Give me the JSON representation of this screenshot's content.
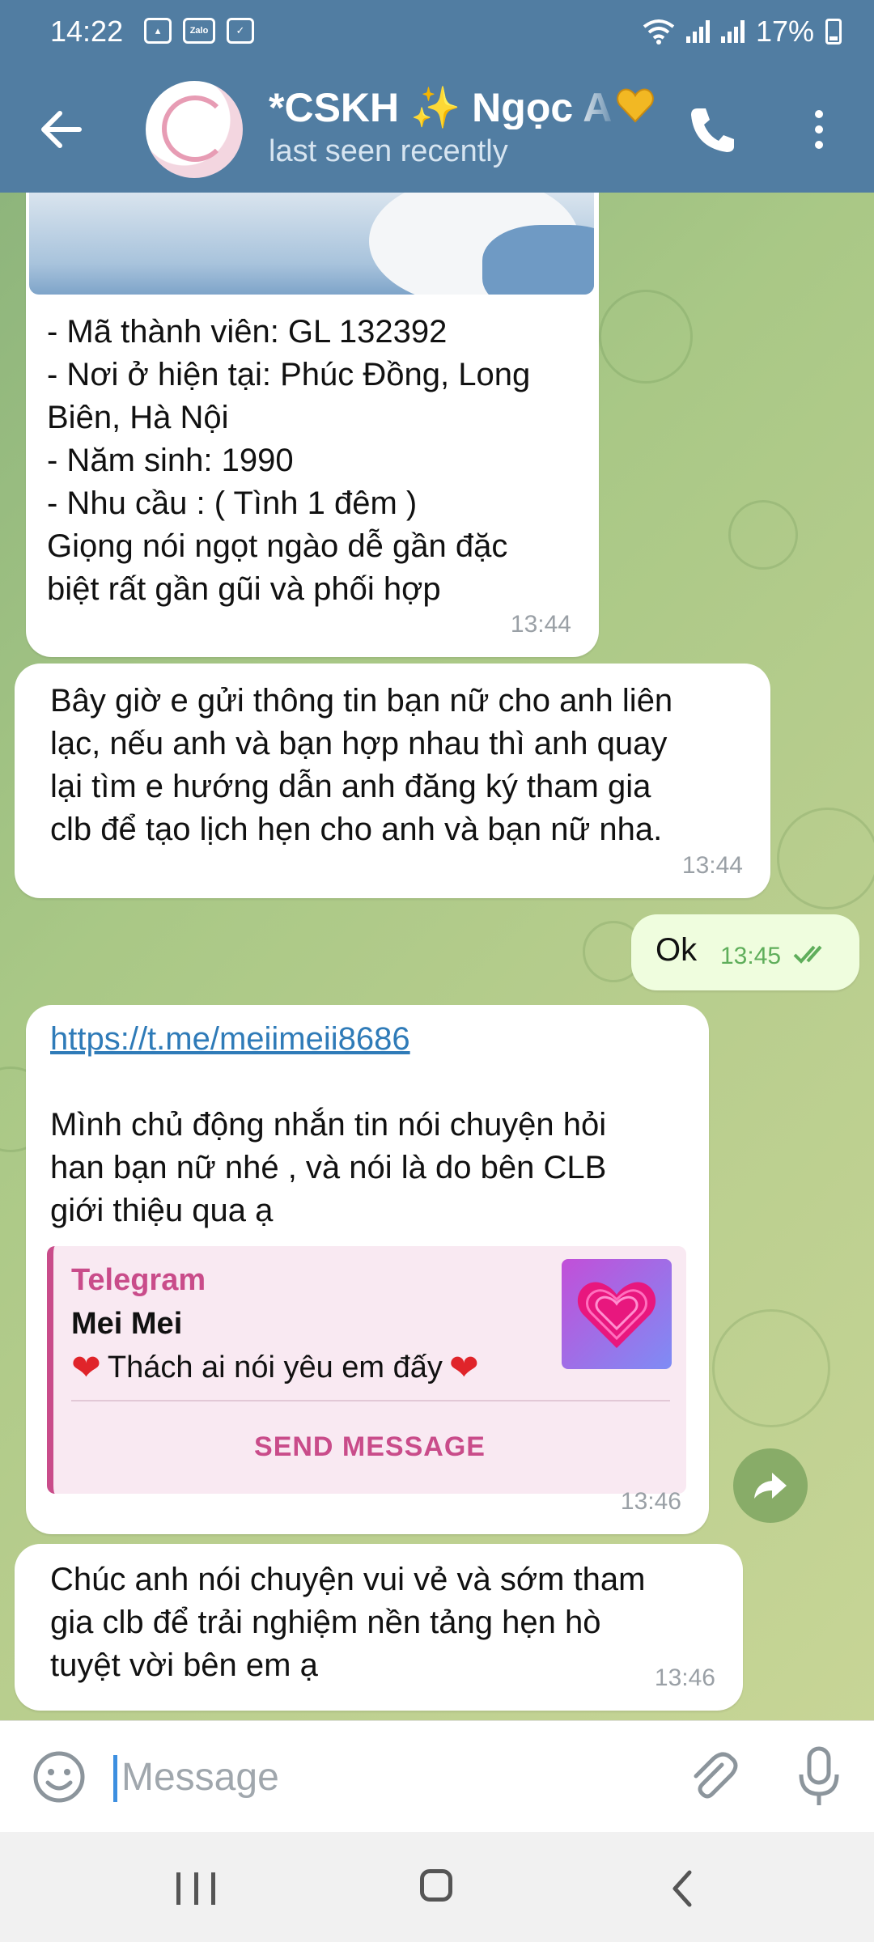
{
  "status_bar": {
    "time": "14:22",
    "notif_icons": [
      "gallery-icon",
      "zalo-icon",
      "check-icon"
    ],
    "zalo_label": "Zalo",
    "battery": "17%"
  },
  "header": {
    "title": "*CSKH ✨ Ngọc A",
    "subtitle": "last seen recently",
    "color": "#517da2"
  },
  "messages": [
    {
      "direction": "incoming",
      "has_photo": true,
      "text_lines": [
        "- Mã thành viên: GL 132392",
        "- Nơi ở hiện tại:  Phúc Đồng, Long",
        "Biên, Hà Nội",
        "- Năm sinh: 1990",
        "- Nhu cầu : ( Tình 1 đêm  )",
        "Giọng nói ngọt ngào dễ gần đặc",
        "biệt rất gần gũi và phối hợp"
      ],
      "time": "13:44"
    },
    {
      "direction": "incoming",
      "text_lines": [
        "Bây giờ e gửi thông tin bạn nữ cho anh liên",
        "lạc, nếu anh và bạn  hợp nhau thì anh quay",
        "lại tìm e hướng dẫn anh đăng ký tham gia",
        "clb để tạo lịch hẹn cho anh và bạn nữ nha."
      ],
      "time": "13:44"
    },
    {
      "direction": "outgoing",
      "text": "Ok",
      "time": "13:45",
      "read": true
    },
    {
      "direction": "incoming",
      "link": "https://t.me/meiimeii8686",
      "text_lines": [
        "Mình chủ động nhắn tin nói chuyện hỏi",
        "han bạn nữ nhé , và nói là do bên CLB",
        "giới thiệu qua ạ"
      ],
      "preview": {
        "site": "Telegram",
        "name": "Mei Mei",
        "description": "Thách ai nói yêu em đấy",
        "button": "SEND MESSAGE"
      },
      "time": "13:46"
    },
    {
      "direction": "incoming",
      "text_lines": [
        "Chúc anh nói chuyện vui vẻ và sớm tham",
        "gia clb để trải nghiệm nền tảng hẹn hò",
        "tuyệt vời bên em ạ"
      ],
      "time": "13:46"
    }
  ],
  "input": {
    "placeholder": "Message"
  }
}
